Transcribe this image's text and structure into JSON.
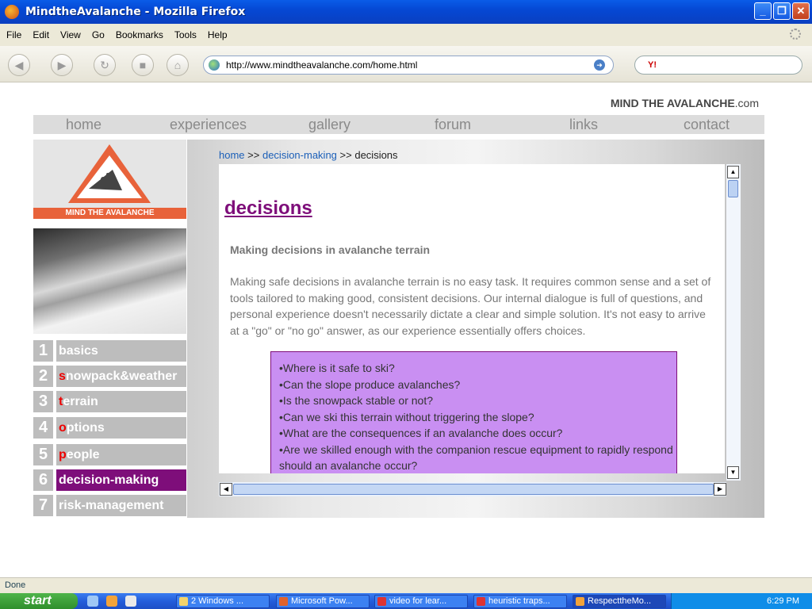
{
  "window": {
    "title": "MindtheAvalanche -  Mozilla Firefox"
  },
  "menu": [
    "File",
    "Edit",
    "View",
    "Go",
    "Bookmarks",
    "Tools",
    "Help"
  ],
  "nav": {
    "url": "http://www.mindtheavalanche.com/home.html",
    "search_engine": "Y!"
  },
  "site": {
    "brand_bold": "MIND THE AVALANCHE",
    "brand_suffix": ".com",
    "topnav": [
      "home",
      "experiences",
      "gallery",
      "forum",
      "links",
      "contact"
    ],
    "logo_text": "MIND THE AVALANCHE",
    "sidebar": [
      {
        "num": "1",
        "first": "",
        "rest": "basics"
      },
      {
        "num": "2",
        "first": "s",
        "rest": "nowpack&weather"
      },
      {
        "num": "3",
        "first": "t",
        "rest": "errain"
      },
      {
        "num": "4",
        "first": "o",
        "rest": "ptions"
      },
      {
        "num": "5",
        "first": "p",
        "rest": "eople"
      },
      {
        "num": "6",
        "first": "",
        "rest": "decision-making"
      },
      {
        "num": "7",
        "first": "",
        "rest": "risk-management"
      }
    ]
  },
  "breadcrumb": {
    "home": "home",
    "sep": ">>",
    "section": "decision-making",
    "current": "decisions"
  },
  "content": {
    "title": "decisions",
    "subtitle": "Making decisions in avalanche terrain",
    "paragraph": "Making safe decisions in avalanche terrain is no easy task. It requires common sense and a set of tools tailored to making good, consistent decisions. Our internal dialogue is full of questions, and personal experience doesn't necessarily dictate a clear and simple solution. It's not easy to arrive at a \"go\" or \"no go\" answer, as our experience essentially offers choices.",
    "questions": [
      "•Where is it safe to ski?",
      "•Can the slope produce avalanches?",
      "•Is the snowpack stable or not?",
      "•Can we ski this terrain without triggering the slope?",
      "•What are the consequences if an avalanche does occur?",
      "•Are we skilled enough with the companion rescue equipment to rapidly respond should an avalanche occur?"
    ]
  },
  "status": "Done",
  "taskbar": {
    "start": "start",
    "items": [
      "2 Windows ...",
      "Microsoft Pow...",
      "video for lear...",
      "heuristic traps...",
      "RespecttheMo..."
    ],
    "clock": "6:29 PM"
  },
  "colors": {
    "accent": "#7e0e7a",
    "logo_bar": "#e8623a",
    "question_box": "#c98ff2",
    "nav_gray": "#dcdcdc"
  }
}
